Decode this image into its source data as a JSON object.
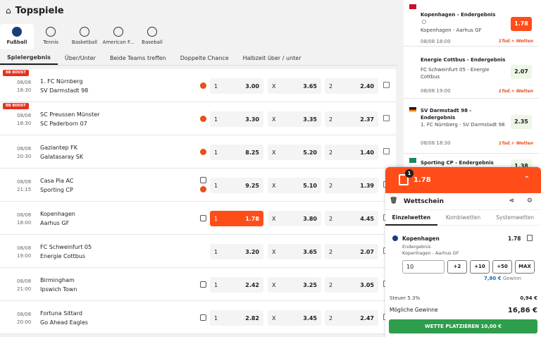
{
  "header": {
    "title": "Topspiele"
  },
  "sports": [
    {
      "label": "Fußball",
      "active": true
    },
    {
      "label": "Tennis"
    },
    {
      "label": "Basketball"
    },
    {
      "label": "American F..."
    },
    {
      "label": "Baseball"
    }
  ],
  "markets": [
    "Spielergebnis",
    "Über/Unter",
    "Beide Teams treffen",
    "Doppelte Chance",
    "Halbzeit über / unter"
  ],
  "matches": [
    {
      "boost": "BB BOOST",
      "date": "08/08",
      "time": "18:30",
      "home": "1. FC Nürnberg",
      "away": "SV Darmstadt 98",
      "odds": [
        "3.00",
        "3.65",
        "2.40"
      ]
    },
    {
      "boost": "BB BOOST",
      "date": "08/08",
      "time": "18:30",
      "home": "SC Preussen Münster",
      "away": "SC Paderborn 07",
      "odds": [
        "3.30",
        "3.35",
        "2.37"
      ]
    },
    {
      "date": "08/08",
      "time": "20:30",
      "home": "Gaziantep FK",
      "away": "Galatasaray SK",
      "odds": [
        "8.25",
        "5.20",
        "1.40"
      ]
    },
    {
      "date": "08/08",
      "time": "21:15",
      "home": "Casa Pia AC",
      "away": "Sporting CP",
      "odds": [
        "9.25",
        "5.10",
        "1.39"
      ]
    },
    {
      "date": "08/08",
      "time": "18:00",
      "home": "Kopenhagen",
      "away": "Aarhus GF",
      "odds": [
        "1.78",
        "3.80",
        "4.45"
      ]
    },
    {
      "date": "08/08",
      "time": "19:00",
      "home": "FC Schweinfurt 05",
      "away": "Energie Cottbus",
      "odds": [
        "3.20",
        "3.65",
        "2.07"
      ]
    },
    {
      "date": "08/08",
      "time": "21:00",
      "home": "Birmingham",
      "away": "Ipswich Town",
      "odds": [
        "2.42",
        "3.25",
        "3.05"
      ]
    },
    {
      "date": "08/08",
      "time": "20:00",
      "home": "Fortuna Sittard",
      "away": "Go Ahead Eagles",
      "odds": [
        "2.82",
        "3.45",
        "2.47"
      ]
    }
  ],
  "odd_labels": [
    "1",
    "X",
    "2"
  ],
  "right": [
    {
      "title": "Kopenhagen - Endergebnis",
      "sub": "Kopenhagen - Aarhus GF",
      "dt": "08/08 18:00",
      "odd": "1.78",
      "pop": "1Tsd.+ Wetten"
    },
    {
      "title": "Energie Cottbus - Endergebnis",
      "sub": "FC Schweinfurt 05 - Energie Cottbus",
      "dt": "08/08 19:00",
      "odd": "2.07",
      "pop": "1Tsd.+ Wetten"
    },
    {
      "title": "SV Darmstadt 98 - Endergebnis",
      "sub": "1. FC Nürnberg - SV Darmstadt 98",
      "dt": "08/08 18:30",
      "odd": "2.35",
      "pop": "1Tsd.+ Wetten"
    },
    {
      "title": "Sporting CP - Endergebnis",
      "odd": "1.38"
    }
  ],
  "slip": {
    "count": "1",
    "total_odd": "1.78",
    "title": "Wettschein",
    "tabs": [
      "Einzelwetten",
      "Kombiwetten",
      "Systemwetten"
    ],
    "bet": {
      "team": "Kopenhagen",
      "odd": "1.78",
      "market": "Endergebnis",
      "match": "Kopenhagen - Aarhus GF"
    },
    "stake": "10",
    "quick": [
      "+2",
      "+10",
      "+50",
      "MAX"
    ],
    "gain_value": "7,80 €",
    "gain_label": "Gewinn",
    "tax_label": "Steuer 5.3%",
    "tax_value": "0,94 €",
    "win_label": "Mögliche Gewinne",
    "win_value": "16,86 €",
    "place": "WETTE PLATZIEREN 10,00 €"
  }
}
